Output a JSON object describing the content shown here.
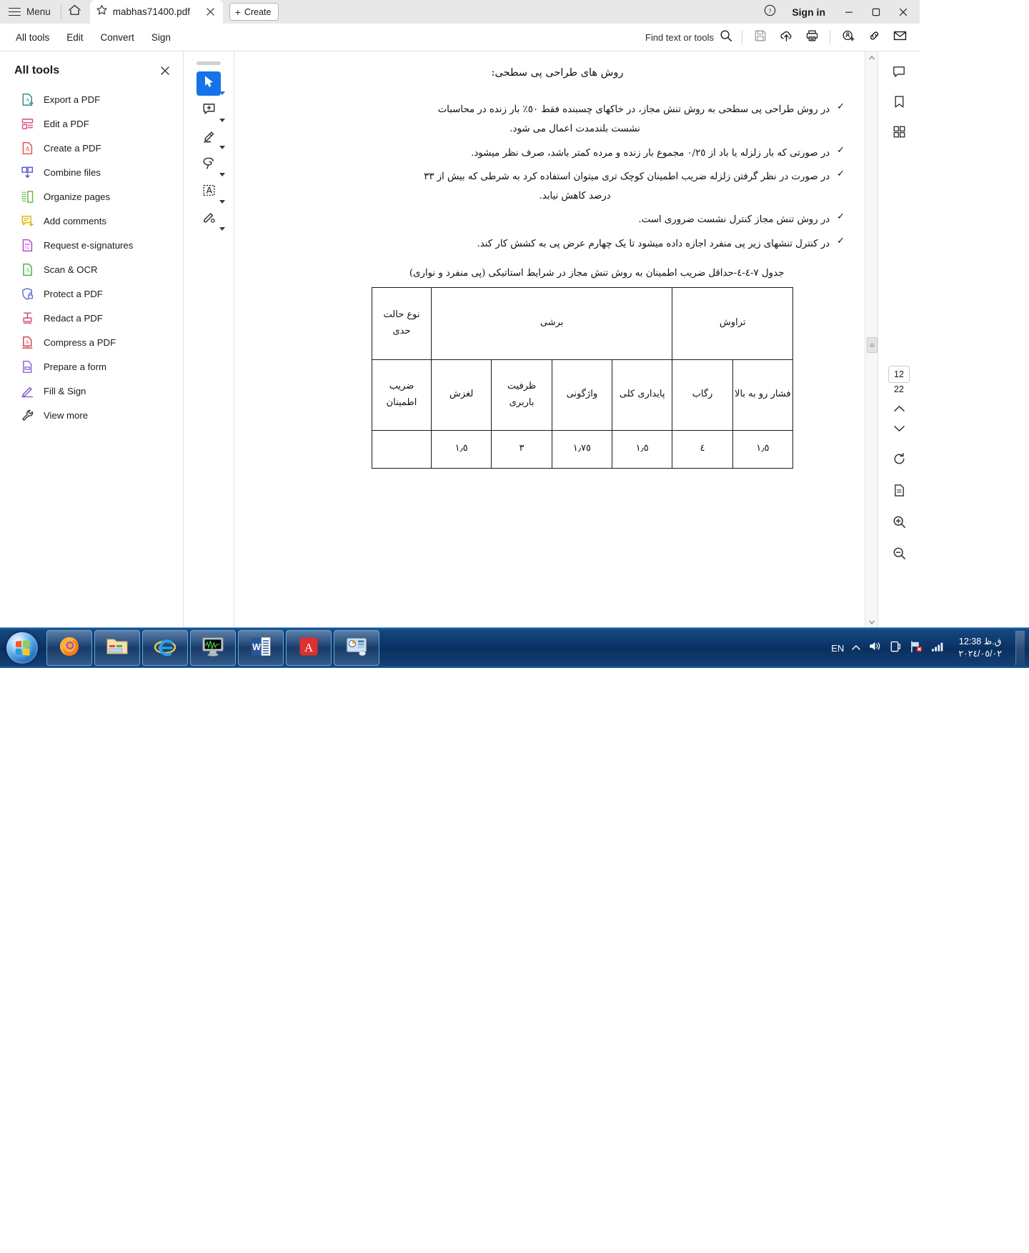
{
  "window": {
    "menu_label": "Menu",
    "home_icon": "home-icon",
    "tab_title": "mabhas71400.pdf",
    "create_label": "Create",
    "sign_in_label": "Sign in",
    "help_icon": "help-circle-icon",
    "minimize_icon": "minimize-icon",
    "maximize_icon": "maximize-icon",
    "close_icon": "close-icon"
  },
  "commandbar": {
    "items": [
      {
        "label": "All tools",
        "name": "all-tools"
      },
      {
        "label": "Edit",
        "name": "edit"
      },
      {
        "label": "Convert",
        "name": "convert"
      },
      {
        "label": "Sign",
        "name": "sign"
      }
    ],
    "find_label": "Find text or tools",
    "icons": [
      "search-icon",
      "save-icon",
      "cloud-upload-icon",
      "print-icon",
      "add-stamp-icon",
      "link-icon",
      "email-icon"
    ]
  },
  "tools_panel": {
    "title": "All tools",
    "close_icon": "close-icon",
    "items": [
      {
        "label": "Export a PDF",
        "icon": "export-pdf-icon",
        "color": "#2b8a8a"
      },
      {
        "label": "Edit a PDF",
        "icon": "edit-pdf-icon",
        "color": "#e0457b"
      },
      {
        "label": "Create a PDF",
        "icon": "create-pdf-icon",
        "color": "#e34f4f"
      },
      {
        "label": "Combine files",
        "icon": "combine-files-icon",
        "color": "#5b55d6"
      },
      {
        "label": "Organize pages",
        "icon": "organize-pages-icon",
        "color": "#63b835"
      },
      {
        "label": "Add comments",
        "icon": "add-comments-icon",
        "color": "#d8b400"
      },
      {
        "label": "Request e-signatures",
        "icon": "request-signatures-icon",
        "color": "#c13bd6"
      },
      {
        "label": "Scan & OCR",
        "icon": "scan-ocr-icon",
        "color": "#3fae4a"
      },
      {
        "label": "Protect a PDF",
        "icon": "protect-pdf-icon",
        "color": "#5b6fd6"
      },
      {
        "label": "Redact a PDF",
        "icon": "redact-pdf-icon",
        "color": "#d6457b"
      },
      {
        "label": "Compress a PDF",
        "icon": "compress-pdf-icon",
        "color": "#d44040"
      },
      {
        "label": "Prepare a form",
        "icon": "prepare-form-icon",
        "color": "#8a63d6"
      },
      {
        "label": "Fill & Sign",
        "icon": "fill-sign-icon",
        "color": "#7a4fd0"
      },
      {
        "label": "View more",
        "icon": "view-more-icon",
        "color": "#3b3b3b"
      }
    ]
  },
  "annotation_rail": {
    "tools": [
      {
        "name": "select-tool",
        "icon": "cursor-icon",
        "active": true
      },
      {
        "name": "comment-tool",
        "icon": "add-comment-icon",
        "active": false
      },
      {
        "name": "highlight-tool",
        "icon": "highlighter-icon",
        "active": false
      },
      {
        "name": "draw-tool",
        "icon": "freehand-draw-icon",
        "active": false
      },
      {
        "name": "text-edit-tool",
        "icon": "select-text-icon",
        "active": false
      },
      {
        "name": "fill-sign-tool",
        "icon": "sign-pen-icon",
        "active": false
      }
    ]
  },
  "right_rail": {
    "icons": [
      "comment-panel-icon",
      "bookmark-icon",
      "thumbnails-icon"
    ],
    "page_current": "12",
    "page_total": "22",
    "nav_icons": [
      "chevron-up-icon",
      "chevron-down-icon",
      "rotate-icon",
      "page-fit-icon",
      "zoom-in-icon",
      "zoom-out-icon"
    ]
  },
  "document": {
    "title": "روش های طراحی پی سطحی:",
    "check_mark": "✓",
    "bullets": [
      {
        "text": "در روش طراحی پی سطحی به روش تنش مجاز، در خاکهای چسبنده فقط ٥٠٪ بار زنده در محاسبات",
        "cont": "نشست بلندمدت اعمال می شود."
      },
      {
        "text": "در صورتی که بار زلزله یا باد از ٠/٢٥ مجموع بار زنده و مرده کمتر باشد، صرف نظر میشود.",
        "cont": ""
      },
      {
        "text": "در صورت در نظر گرفتن زلزله ضریب اطمینان کوچک تری میتوان استفاده کرد به شرطی که بیش از ٣٣",
        "cont": "درصد کاهش نیابد."
      },
      {
        "text": "در روش تنش مجاز کنترل نشست ضروری است.",
        "cont": ""
      },
      {
        "text": "در کنترل تنشهای زیر پی منفرد اجازه داده میشود تا یک چهارم عرض پی به کشش کار کند.",
        "cont": ""
      }
    ],
    "table_caption": "جدول ٧-٤-٤-حداقل ضریب اطمینان به روش تنش مجاز در شرایط استاتیکی (پی منفرد و نواری)",
    "table": {
      "group_row": [
        "تراوش",
        "برشی",
        "نوع حالت حدی"
      ],
      "header_row": [
        "فشار رو به بالا",
        "رگاب",
        "پایداری کلی",
        "واژگونی",
        "ظرفیت باربری",
        "لغزش",
        "ضریب اطمینان"
      ],
      "value_row": [
        "١٫٥",
        "٤",
        "١٫٥",
        "١٫٧٥",
        "٣",
        "١٫٥"
      ]
    }
  },
  "taskbar": {
    "start_icon": "windows-start-icon",
    "apps": [
      {
        "name": "firefox-taskbar-icon"
      },
      {
        "name": "file-explorer-taskbar-icon"
      },
      {
        "name": "internet-explorer-taskbar-icon"
      },
      {
        "name": "monitor-taskbar-icon"
      },
      {
        "name": "word-taskbar-icon"
      },
      {
        "name": "acrobat-taskbar-icon"
      },
      {
        "name": "utility-taskbar-icon"
      }
    ],
    "language": "EN",
    "tray_icons": [
      "show-hidden-icon",
      "volume-icon",
      "power-icon",
      "network-flag-icon",
      "signal-icon"
    ],
    "time": "12:38 ق.ظ",
    "date": "٢٠٢٤/٠٥/٠٢"
  }
}
